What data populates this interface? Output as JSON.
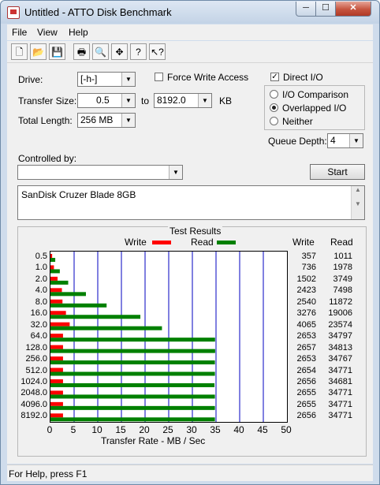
{
  "window": {
    "title": "Untitled - ATTO Disk Benchmark",
    "min_glyph": "─",
    "max_glyph": "☐",
    "close_glyph": "✕"
  },
  "menu": [
    {
      "label": "File"
    },
    {
      "label": "View"
    },
    {
      "label": "Help"
    }
  ],
  "toolbar": [
    {
      "icon": "new-document-icon",
      "glyph": "🗋"
    },
    {
      "icon": "open-folder-icon",
      "glyph": "📂"
    },
    {
      "icon": "save-icon",
      "glyph": "💾"
    },
    {
      "icon": "print-icon",
      "glyph": "🖶"
    },
    {
      "icon": "print-preview-icon",
      "glyph": "🔍"
    },
    {
      "icon": "move-icon",
      "glyph": "✥"
    },
    {
      "icon": "help-icon",
      "glyph": "?"
    },
    {
      "icon": "context-help-icon",
      "glyph": "↖?"
    }
  ],
  "settings": {
    "drive_label": "Drive:",
    "drive_value": "[-h-]",
    "force_write_label": "Force Write Access",
    "direct_io_label": "Direct I/O",
    "direct_io_checked": true,
    "transfer_label": "Transfer Size:",
    "transfer_from": "0.5",
    "transfer_to_label": "to",
    "transfer_to": "8192.0",
    "transfer_unit": "KB",
    "total_length_label": "Total Length:",
    "total_length_value": "256 MB",
    "io_modes": [
      {
        "label": "I/O Comparison",
        "selected": false
      },
      {
        "label": "Overlapped I/O",
        "selected": true
      },
      {
        "label": "Neither",
        "selected": false
      }
    ],
    "queue_depth_label": "Queue Depth:",
    "queue_depth_value": "4",
    "controlled_by_label": "Controlled by:",
    "controlled_by_value": "",
    "start_label": "Start"
  },
  "device_info": "SanDisk Cruzer Blade 8GB",
  "results": {
    "group_label": "Test Results",
    "legend_write": "Write",
    "legend_read": "Read",
    "col_write": "Write",
    "col_read": "Read",
    "write_color": "#ff0000",
    "read_color": "#008000",
    "grid_color": "#0000c0"
  },
  "chart_data": {
    "type": "bar",
    "orientation": "horizontal",
    "xlabel": "Transfer Rate - MB / Sec",
    "xlim": [
      0,
      50
    ],
    "xticks": [
      0,
      5,
      10,
      15,
      20,
      25,
      30,
      35,
      40,
      45,
      50
    ],
    "categories": [
      "0.5",
      "1.0",
      "2.0",
      "4.0",
      "8.0",
      "16.0",
      "32.0",
      "64.0",
      "128.0",
      "256.0",
      "512.0",
      "1024.0",
      "2048.0",
      "4096.0",
      "8192.0"
    ],
    "series": [
      {
        "name": "Write",
        "values": [
          357,
          736,
          1502,
          2423,
          2540,
          3276,
          4065,
          2653,
          2657,
          2653,
          2654,
          2656,
          2655,
          2655,
          2656
        ]
      },
      {
        "name": "Read",
        "values": [
          1011,
          1978,
          3749,
          7498,
          11872,
          19006,
          23574,
          34797,
          34813,
          34767,
          34771,
          34681,
          34771,
          34771,
          34771
        ]
      }
    ],
    "grid": true
  },
  "status": "For Help, press F1"
}
